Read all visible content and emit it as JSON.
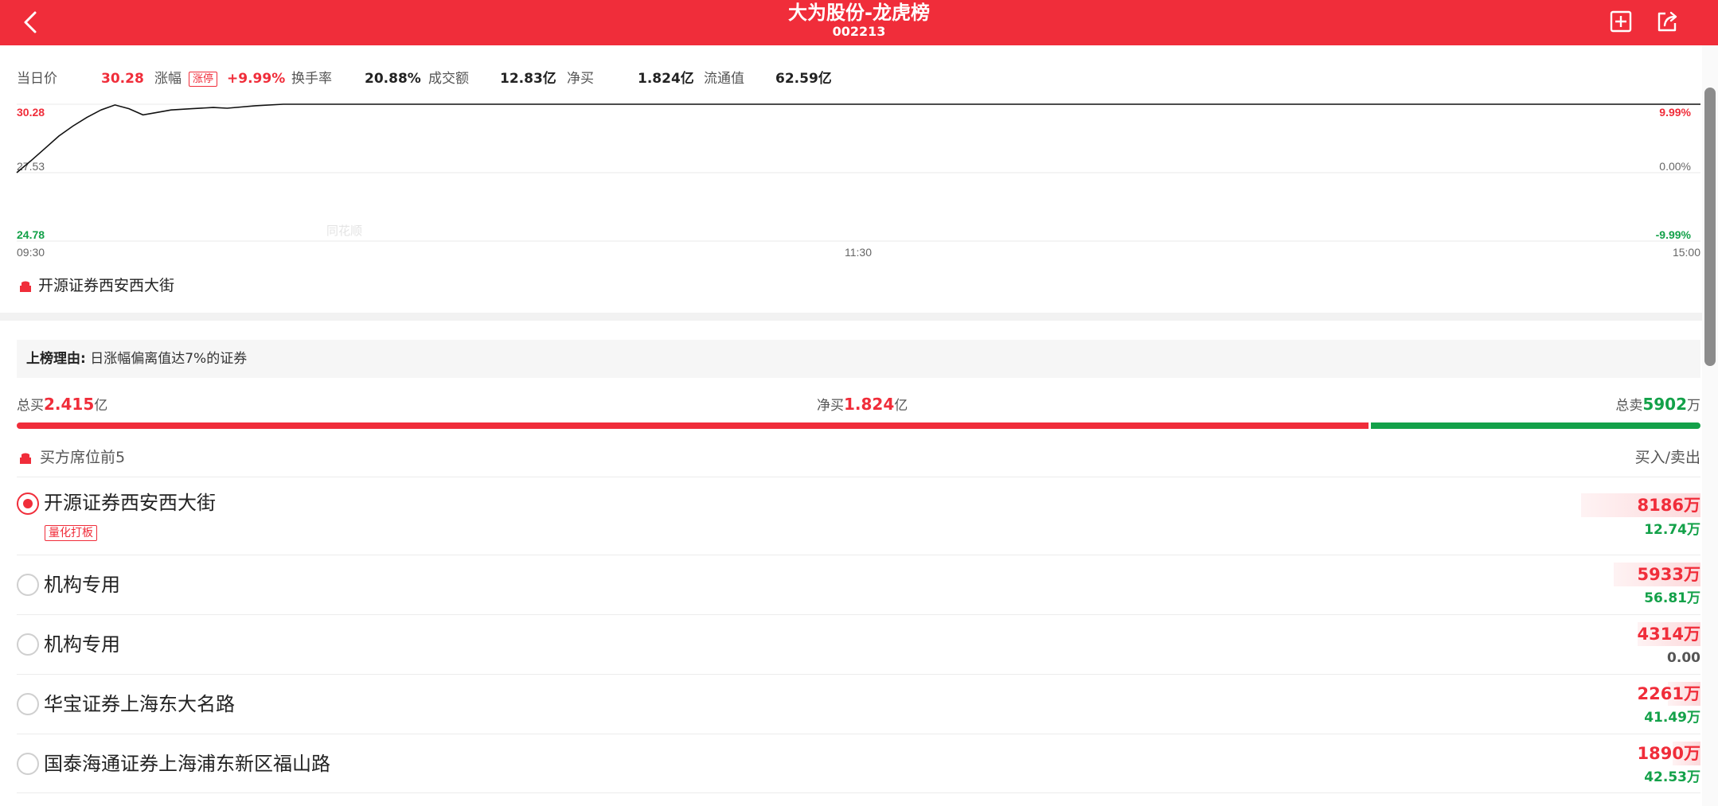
{
  "header": {
    "title": "大为股份-龙虎榜",
    "code": "002213",
    "back_icon": "chevron-left-icon",
    "add_icon": "plus-square-icon",
    "share_icon": "share-icon"
  },
  "colors": {
    "brand": "#f02d3a",
    "up": "#f02d3a",
    "down": "#13a149"
  },
  "stats": {
    "price_label": "当日价",
    "price_value": "30.28",
    "change_label": "涨幅",
    "limit_badge": "涨停",
    "change_value": "+9.99%",
    "turnover_label": "换手率",
    "turnover_value": "20.88%",
    "volume_label": "成交额",
    "volume_value": "12.83亿",
    "net_label": "净买",
    "net_value": "1.824亿",
    "float_label": "流通值",
    "float_value": "62.59亿"
  },
  "chart_data": {
    "type": "line",
    "x_labels": [
      "09:30",
      "11:30",
      "15:00"
    ],
    "y_left": [
      "30.28",
      "27.53",
      "24.78"
    ],
    "y_right": [
      "9.99%",
      "0.00%",
      "-9.99%"
    ],
    "ylim": [
      24.78,
      30.28
    ],
    "x_range_minutes": [
      0,
      240
    ],
    "series": [
      {
        "x": [
          0,
          2,
          4,
          6,
          8,
          10,
          12,
          14,
          16,
          18,
          20,
          22,
          25,
          28,
          30,
          34,
          38,
          42,
          46,
          50,
          240
        ],
        "values": [
          27.53,
          28.0,
          28.5,
          29.0,
          29.4,
          29.75,
          30.05,
          30.25,
          30.1,
          29.85,
          29.95,
          30.05,
          30.1,
          30.15,
          30.12,
          30.22,
          30.28,
          30.28,
          30.28,
          30.28,
          30.28
        ]
      }
    ]
  },
  "watermark": "同花顺",
  "broker_tag": "开源证券西安西大街",
  "reason": {
    "label": "上榜理由:",
    "text": "日涨幅偏离值达7%的证券"
  },
  "summary": {
    "total_buy_label": "总买",
    "total_buy_value": "2.415",
    "total_buy_unit": "亿",
    "net_buy_label": "净买",
    "net_buy_value": "1.824",
    "net_buy_unit": "亿",
    "total_sell_label": "总卖",
    "total_sell_value": "5902",
    "total_sell_unit": "万",
    "buy_ratio": 0.8036
  },
  "list": {
    "title": "买方席位前5",
    "right_label": "买入/卖出",
    "rows": [
      {
        "name": "开源证券西安西大街",
        "tag": "量化打板",
        "buy": "8186万",
        "sell": "12.74万",
        "selected": true,
        "buy_ratio": 1.0
      },
      {
        "name": "机构专用",
        "buy": "5933万",
        "sell": "56.81万",
        "selected": false,
        "buy_ratio": 0.725
      },
      {
        "name": "机构专用",
        "buy": "4314万",
        "sell": "0.00",
        "selected": false,
        "buy_ratio": 0.527
      },
      {
        "name": "华宝证券上海东大名路",
        "buy": "2261万",
        "sell": "41.49万",
        "selected": false,
        "buy_ratio": 0.276
      },
      {
        "name": "国泰海通证券上海浦东新区福山路",
        "buy": "1890万",
        "sell": "42.53万",
        "selected": false,
        "buy_ratio": 0.231
      }
    ]
  }
}
